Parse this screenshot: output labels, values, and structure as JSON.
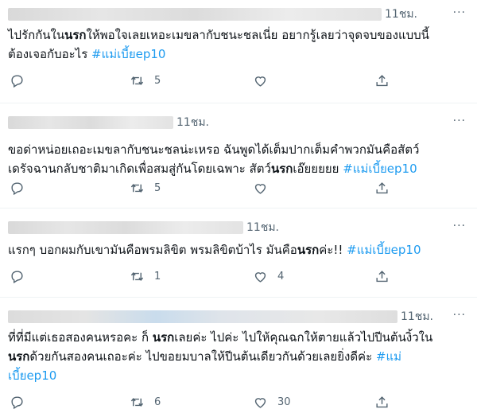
{
  "tweets": [
    {
      "time": "11ชม.",
      "more": "···",
      "line1": "ไปรักกันใน",
      "bold1": "นรก",
      "line1b": "ให้พอใจเลยเหอะเมขลากับชนะชลเนี่ย อยากรู้เลยว่าจุดจบของแบบนี้",
      "line2": "ต้องเจอกับอะไร ",
      "hashtag": "#แม่เบี้ยep10",
      "retweets": "5",
      "likes": ""
    },
    {
      "time": "11ชม.",
      "more": "···",
      "line1": "ขอด่าหน่อยเถอะเมขลากับชนะชลน่ะเหรอ ฉันพูดได้เต็มปากเต็มคำพวกมันคือสัตว์",
      "line2": "เดรัจฉานกลับชาติมาเกิดเพื่อสมสู่กันโดยเฉพาะ สัตว์",
      "bold2": "นรก",
      "line2b": "เอ๊ยยยยย ",
      "hashtag": "#แม่เบี้ยep10",
      "retweets": "5",
      "likes": ""
    },
    {
      "time": "11ชม.",
      "more": "···",
      "line1": "แรกๆ บอกผมกับเขามันคือพรมลิขิต พรมลิขิตบ้าไร มันคือ",
      "bold1": "นรก",
      "line1b": "ค่ะ!! ",
      "hashtag": "#แม่เบี้ยep10",
      "retweets": "1",
      "likes": "4"
    },
    {
      "time": "11ชม.",
      "more": "···",
      "line1": "ที่ที่มีแต่เธอสองคนหรอคะ ก็ ",
      "bold1": "นรก",
      "line1b": "เลยค่ะ ไปค่ะ ไปให้คุณฉกให้ตายแล้วไปปีนต้นงิ้วใน",
      "bold2": "นรก",
      "line2b": "ด้วยกันสองคนเถอะค่ะ ไปขอยมบาลให้ปีนต้นเดียวกันด้วยเลยยิ่งดีค่ะ ",
      "hashtag_a": "#แม่",
      "hashtag_b": "เบี้ยep10",
      "retweets": "6",
      "likes": "30"
    }
  ]
}
